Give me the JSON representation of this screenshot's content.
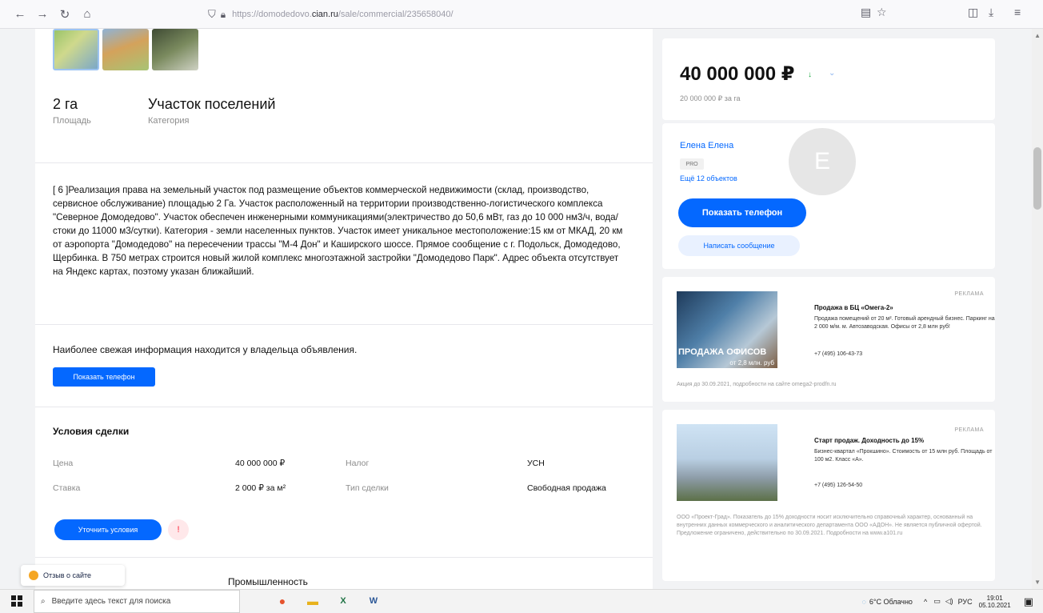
{
  "browser": {
    "url_prefix": "https://domodedovo.",
    "url_domain": "cian.ru",
    "url_suffix": "/sale/commercial/235658040/",
    "icons": [
      "back-icon",
      "forward-icon",
      "reload-icon",
      "home-icon",
      "shield-icon",
      "lock-icon",
      "reader-icon",
      "bookmark-star-icon",
      "pocket-icon",
      "downloads-icon",
      "menu-icon"
    ]
  },
  "listing": {
    "area_value": "2 га",
    "area_label": "Площадь",
    "category_value": "Участок поселений",
    "category_label": "Категория",
    "description": "[ 6 ]Реализация права на земельный участок под размещение объектов коммерческой недвижимости (склад, производство, сервисное обслуживание) площадью 2 Га. Участок расположенный на территории производственно-логистического комплекса \"Северное Домодедово\". Участок обеспечен инженерными коммуникациями(электричество до 50,6 мВт, газ до 10 000 нм3/ч, вода/стоки до 11000 м3/сутки). Категория - земли населенных пунктов. Участок имеет уникальное местоположение:15 км от МКАД, 20 км от аэропорта \"Домодедово\" на пересечении трассы \"М-4 Дон\" и Каширского шоссе. Прямое сообщение с г. Подольск, Домодедово, Щербинка. В 750 метрах строится новый жилой комплекс многоэтажной застройки \"Домодедово Парк\". Адрес объекта отсутствует на Яндекс картах, поэтому указан ближайший.",
    "fresh_info": "Наиболее свежая информация находится у владельца объявления.",
    "show_phone_label": "Показать телефон"
  },
  "deal": {
    "title": "Условия сделки",
    "price_label": "Цена",
    "price_value": "40 000 000 ₽",
    "tax_label": "Налог",
    "tax_value": "УСН",
    "rate_label": "Ставка",
    "rate_value": "2 000 ₽ за м²",
    "type_label": "Тип сделки",
    "type_value": "Свободная продажа",
    "clarify_label": "Уточнить условия",
    "warn_icon": "!"
  },
  "industry": "Промышленность",
  "feedback_label": "Отзыв о сайте",
  "sidebar": {
    "price": "40 000 000 ₽",
    "price_trend_icon": "↓",
    "price_dropdown_icon": "⌄",
    "price_per": "20 000 000 ₽ за га",
    "agent_name": "Елена Елена",
    "agent_badge": "PRO",
    "agent_more": "Ещё 12 объектов",
    "avatar_letter": "E",
    "show_phone_label": "Показать телефон",
    "write_message_label": "Написать сообщение"
  },
  "ads": [
    {
      "label": "РЕКЛАМА",
      "image_text": "ПРОДАЖА ОФИСОВ",
      "image_sub": "от 2,8 млн. руб",
      "title": "Продажа в БЦ «Омега-2»",
      "text": "Продажа помещений от 20 м². Готовый арендный бизнес. Паркинг на 2 000 м/м. м. Автозаводская. Офисы от 2,8 млн руб!",
      "phone": "+7 (495) 106-43-73",
      "footer": "Акция до 30.09.2021, подробности на сайте omega2-prodfn.ru"
    },
    {
      "label": "РЕКЛАМА",
      "title": "Старт продаж. Доходность до 15%",
      "text": "Бизнес-квартал «Прокшино». Стоимость от 15 млн руб. Площадь от 100 м2. Класс «А».",
      "phone": "+7 (495) 126-54-50",
      "footer": "ООО «Проект-Град». Показатель до 15% доходности носит исключительно справочный характер, основанный на внутренних данных коммерческого и аналитического департамента ООО «АДОН». Не является публичной офертой. Предложение ограничено, действительно по 30.09.2021. Подробности на www.a101.ru"
    }
  ],
  "taskbar": {
    "search_placeholder": "Введите здесь текст для поиска",
    "weather": "6°C Облачно",
    "lang": "РУС",
    "time": "19:01",
    "date": "05.10.2021"
  }
}
